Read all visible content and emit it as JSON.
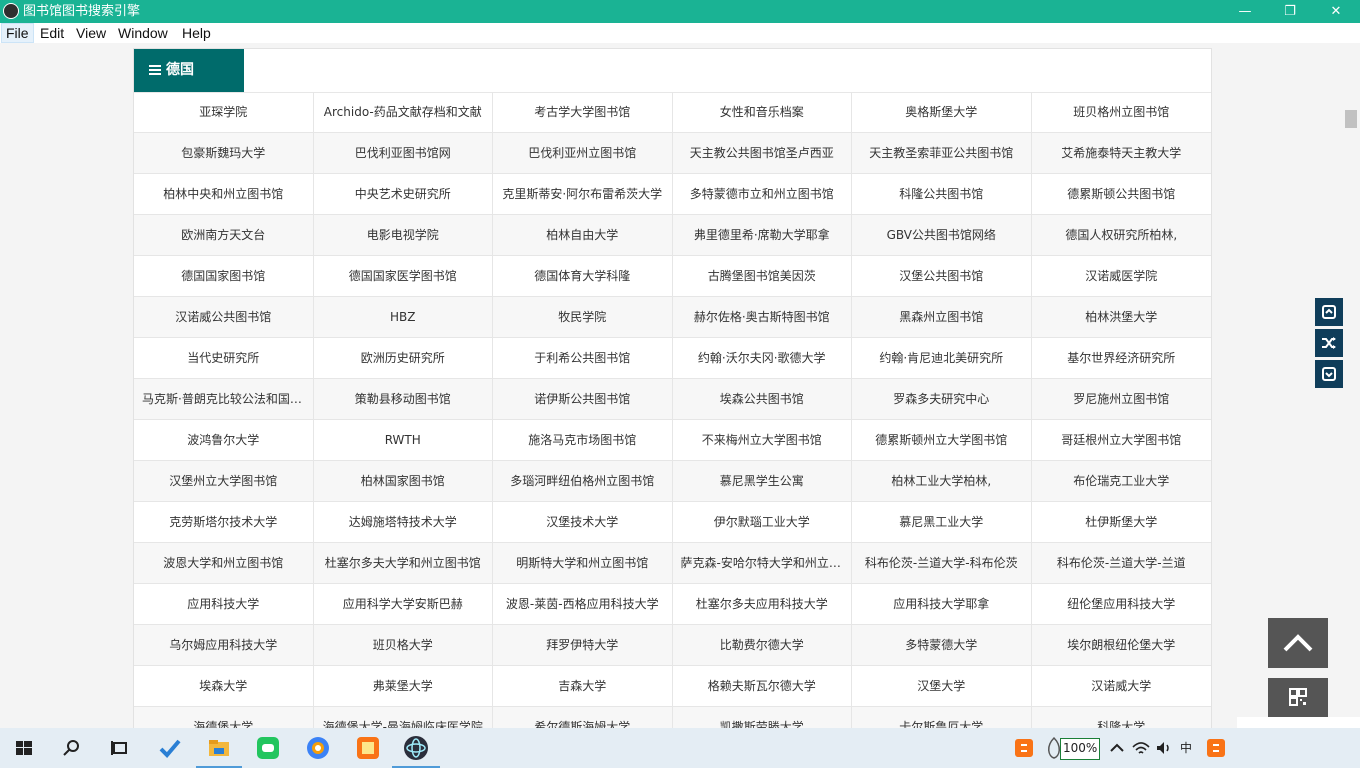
{
  "window": {
    "title": "图书馆图书搜索引擎",
    "minimize": "—",
    "maximize": "❐",
    "close": "✕"
  },
  "menu": [
    "File",
    "Edit",
    "View",
    "Window",
    "Help"
  ],
  "tab": {
    "label": "德国"
  },
  "rows": [
    [
      "亚琛学院",
      "Archido-药品文献存档和文献",
      "考古学大学图书馆",
      "女性和音乐档案",
      "奥格斯堡大学",
      "班贝格州立图书馆"
    ],
    [
      "包豪斯魏玛大学",
      "巴伐利亚图书馆网",
      "巴伐利亚州立图书馆",
      "天主教公共图书馆圣卢西亚",
      "天主教圣索菲亚公共图书馆",
      "艾希施泰特天主教大学"
    ],
    [
      "柏林中央和州立图书馆",
      "中央艺术史研究所",
      "克里斯蒂安·阿尔布雷希茨大学",
      "多特蒙德市立和州立图书馆",
      "科隆公共图书馆",
      "德累斯顿公共图书馆"
    ],
    [
      "欧洲南方天文台",
      "电影电视学院",
      "柏林自由大学",
      "弗里德里希·席勒大学耶拿",
      "GBV公共图书馆网络",
      "德国人权研究所柏林,"
    ],
    [
      "德国国家图书馆",
      "德国国家医学图书馆",
      "德国体育大学科隆",
      "古腾堡图书馆美因茨",
      "汉堡公共图书馆",
      "汉诺威医学院"
    ],
    [
      "汉诺威公共图书馆",
      "HBZ",
      "牧民学院",
      "赫尔佐格·奥古斯特图书馆",
      "黑森州立图书馆",
      "柏林洪堡大学"
    ],
    [
      "当代史研究所",
      "欧洲历史研究所",
      "于利希公共图书馆",
      "约翰·沃尔夫冈·歌德大学",
      "约翰·肯尼迪北美研究所",
      "基尔世界经济研究所"
    ],
    [
      "马克斯·普朗克比较公法和国际法研究所",
      "策勒县移动图书馆",
      "诺伊斯公共图书馆",
      "埃森公共图书馆",
      "罗森多夫研究中心",
      "罗尼施州立图书馆"
    ],
    [
      "波鸿鲁尔大学",
      "RWTH",
      "施洛马克市场图书馆",
      "不来梅州立大学图书馆",
      "德累斯顿州立大学图书馆",
      "哥廷根州立大学图书馆"
    ],
    [
      "汉堡州立大学图书馆",
      "柏林国家图书馆",
      "多瑙河畔纽伯格州立图书馆",
      "慕尼黑学生公寓",
      "柏林工业大学柏林,",
      "布伦瑞克工业大学"
    ],
    [
      "克劳斯塔尔技术大学",
      "达姆施塔特技术大学",
      "汉堡技术大学",
      "伊尔默瑙工业大学",
      "慕尼黑工业大学",
      "杜伊斯堡大学"
    ],
    [
      "波恩大学和州立图书馆",
      "杜塞尔多夫大学和州立图书馆",
      "明斯特大学和州立图书馆",
      "萨克森-安哈尔特大学和州立图书馆",
      "科布伦茨-兰道大学-科布伦茨",
      "科布伦茨-兰道大学-兰道"
    ],
    [
      "应用科技大学",
      "应用科学大学安斯巴赫",
      "波恩-莱茵-西格应用科技大学",
      "杜塞尔多夫应用科技大学",
      "应用科技大学耶拿",
      "纽伦堡应用科技大学"
    ],
    [
      "乌尔姆应用科技大学",
      "班贝格大学",
      "拜罗伊特大学",
      "比勒费尔德大学",
      "多特蒙德大学",
      "埃尔朗根纽伦堡大学"
    ],
    [
      "埃森大学",
      "弗莱堡大学",
      "吉森大学",
      "格赖夫斯瓦尔德大学",
      "汉堡大学",
      "汉诺威大学"
    ],
    [
      "海德堡大学",
      "海德堡大学-曼海姆临床医学院",
      "希尔德斯海姆大学",
      "凯撒斯劳滕大学",
      "卡尔斯鲁厄大学",
      "科隆大学"
    ]
  ],
  "taskbar": {
    "zoom": "100%",
    "ime": "中"
  }
}
